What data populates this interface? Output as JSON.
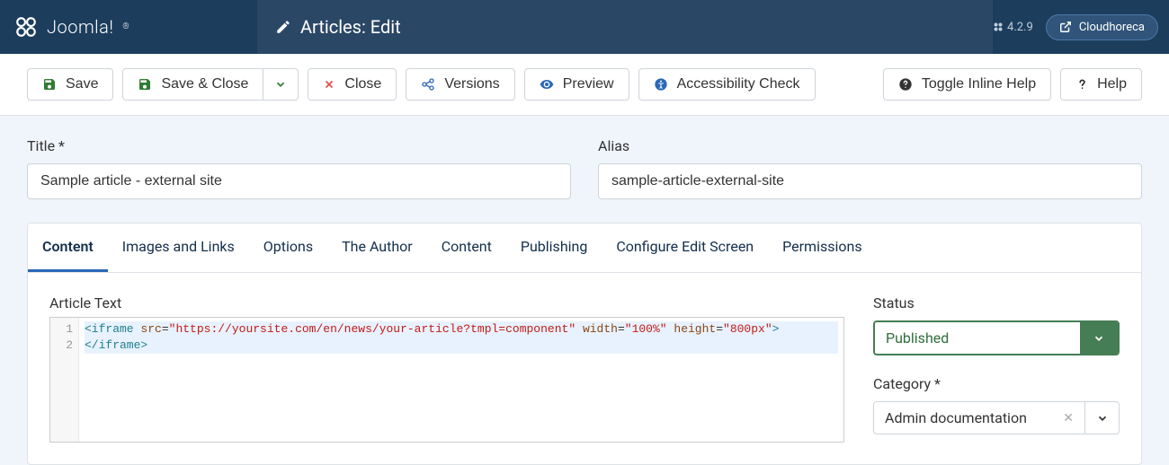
{
  "header": {
    "brand": "Joomla!",
    "page_title": "Articles: Edit",
    "version": "4.2.9",
    "site_name": "Cloudhoreca"
  },
  "toolbar": {
    "save": "Save",
    "save_close": "Save & Close",
    "close": "Close",
    "versions": "Versions",
    "preview": "Preview",
    "accessibility": "Accessibility Check",
    "toggle_help": "Toggle Inline Help",
    "help": "Help"
  },
  "form": {
    "title_label": "Title *",
    "title_value": "Sample article - external site",
    "alias_label": "Alias",
    "alias_value": "sample-article-external-site"
  },
  "tabs": [
    "Content",
    "Images and Links",
    "Options",
    "The Author",
    "Content",
    "Publishing",
    "Configure Edit Screen",
    "Permissions"
  ],
  "active_tab_index": 0,
  "editor": {
    "label": "Article Text",
    "line_numbers": [
      "1",
      "2"
    ],
    "code": {
      "tag_open": "<iframe",
      "attr_src": "src",
      "val_src": "\"https://yoursite.com/en/news/your-article?tmpl=component\"",
      "attr_width": "width",
      "val_width": "\"100%\"",
      "attr_height": "height",
      "val_height": "\"800px\"",
      "tag_open_end": ">",
      "tag_close": "</iframe>"
    }
  },
  "sidebar": {
    "status_label": "Status",
    "status_value": "Published",
    "category_label": "Category *",
    "category_value": "Admin documentation"
  }
}
